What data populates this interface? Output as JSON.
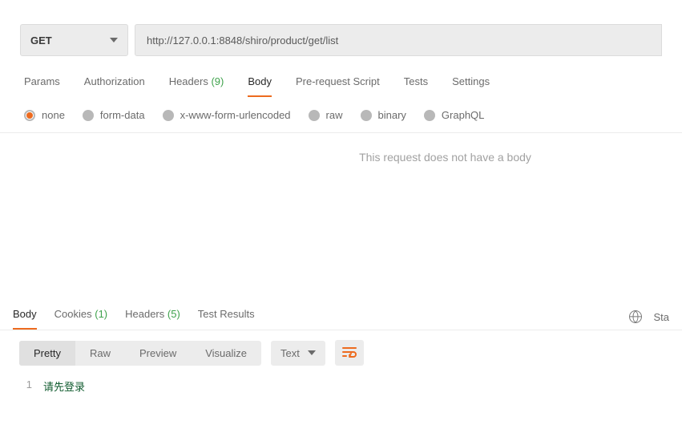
{
  "request": {
    "method": "GET",
    "url": "http://127.0.0.1:8848/shiro/product/get/list"
  },
  "request_tabs": {
    "params": "Params",
    "authorization": "Authorization",
    "headers": "Headers",
    "headers_count": "(9)",
    "body": "Body",
    "prerequest": "Pre-request Script",
    "tests": "Tests",
    "settings": "Settings"
  },
  "body_types": {
    "none": "none",
    "form_data": "form-data",
    "urlencoded": "x-www-form-urlencoded",
    "raw": "raw",
    "binary": "binary",
    "graphql": "GraphQL"
  },
  "body_message": "This request does not have a body",
  "response_tabs": {
    "body": "Body",
    "cookies": "Cookies",
    "cookies_count": "(1)",
    "headers": "Headers",
    "headers_count": "(5)",
    "test_results": "Test Results"
  },
  "status_label": "Sta",
  "view_modes": {
    "pretty": "Pretty",
    "raw": "Raw",
    "preview": "Preview",
    "visualize": "Visualize"
  },
  "format_label": "Text",
  "response_body": {
    "line1_num": "1",
    "line1_content": "请先登录"
  }
}
